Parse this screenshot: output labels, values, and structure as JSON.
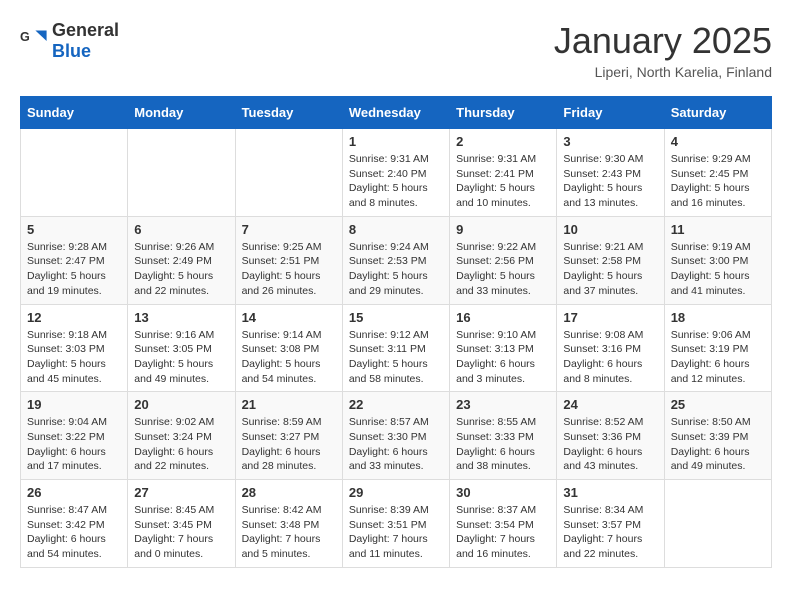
{
  "header": {
    "logo_general": "General",
    "logo_blue": "Blue",
    "month": "January 2025",
    "location": "Liperi, North Karelia, Finland"
  },
  "weekdays": [
    "Sunday",
    "Monday",
    "Tuesday",
    "Wednesday",
    "Thursday",
    "Friday",
    "Saturday"
  ],
  "weeks": [
    [
      {
        "day": "",
        "sunrise": "",
        "sunset": "",
        "daylight": ""
      },
      {
        "day": "",
        "sunrise": "",
        "sunset": "",
        "daylight": ""
      },
      {
        "day": "",
        "sunrise": "",
        "sunset": "",
        "daylight": ""
      },
      {
        "day": "1",
        "sunrise": "Sunrise: 9:31 AM",
        "sunset": "Sunset: 2:40 PM",
        "daylight": "Daylight: 5 hours and 8 minutes."
      },
      {
        "day": "2",
        "sunrise": "Sunrise: 9:31 AM",
        "sunset": "Sunset: 2:41 PM",
        "daylight": "Daylight: 5 hours and 10 minutes."
      },
      {
        "day": "3",
        "sunrise": "Sunrise: 9:30 AM",
        "sunset": "Sunset: 2:43 PM",
        "daylight": "Daylight: 5 hours and 13 minutes."
      },
      {
        "day": "4",
        "sunrise": "Sunrise: 9:29 AM",
        "sunset": "Sunset: 2:45 PM",
        "daylight": "Daylight: 5 hours and 16 minutes."
      }
    ],
    [
      {
        "day": "5",
        "sunrise": "Sunrise: 9:28 AM",
        "sunset": "Sunset: 2:47 PM",
        "daylight": "Daylight: 5 hours and 19 minutes."
      },
      {
        "day": "6",
        "sunrise": "Sunrise: 9:26 AM",
        "sunset": "Sunset: 2:49 PM",
        "daylight": "Daylight: 5 hours and 22 minutes."
      },
      {
        "day": "7",
        "sunrise": "Sunrise: 9:25 AM",
        "sunset": "Sunset: 2:51 PM",
        "daylight": "Daylight: 5 hours and 26 minutes."
      },
      {
        "day": "8",
        "sunrise": "Sunrise: 9:24 AM",
        "sunset": "Sunset: 2:53 PM",
        "daylight": "Daylight: 5 hours and 29 minutes."
      },
      {
        "day": "9",
        "sunrise": "Sunrise: 9:22 AM",
        "sunset": "Sunset: 2:56 PM",
        "daylight": "Daylight: 5 hours and 33 minutes."
      },
      {
        "day": "10",
        "sunrise": "Sunrise: 9:21 AM",
        "sunset": "Sunset: 2:58 PM",
        "daylight": "Daylight: 5 hours and 37 minutes."
      },
      {
        "day": "11",
        "sunrise": "Sunrise: 9:19 AM",
        "sunset": "Sunset: 3:00 PM",
        "daylight": "Daylight: 5 hours and 41 minutes."
      }
    ],
    [
      {
        "day": "12",
        "sunrise": "Sunrise: 9:18 AM",
        "sunset": "Sunset: 3:03 PM",
        "daylight": "Daylight: 5 hours and 45 minutes."
      },
      {
        "day": "13",
        "sunrise": "Sunrise: 9:16 AM",
        "sunset": "Sunset: 3:05 PM",
        "daylight": "Daylight: 5 hours and 49 minutes."
      },
      {
        "day": "14",
        "sunrise": "Sunrise: 9:14 AM",
        "sunset": "Sunset: 3:08 PM",
        "daylight": "Daylight: 5 hours and 54 minutes."
      },
      {
        "day": "15",
        "sunrise": "Sunrise: 9:12 AM",
        "sunset": "Sunset: 3:11 PM",
        "daylight": "Daylight: 5 hours and 58 minutes."
      },
      {
        "day": "16",
        "sunrise": "Sunrise: 9:10 AM",
        "sunset": "Sunset: 3:13 PM",
        "daylight": "Daylight: 6 hours and 3 minutes."
      },
      {
        "day": "17",
        "sunrise": "Sunrise: 9:08 AM",
        "sunset": "Sunset: 3:16 PM",
        "daylight": "Daylight: 6 hours and 8 minutes."
      },
      {
        "day": "18",
        "sunrise": "Sunrise: 9:06 AM",
        "sunset": "Sunset: 3:19 PM",
        "daylight": "Daylight: 6 hours and 12 minutes."
      }
    ],
    [
      {
        "day": "19",
        "sunrise": "Sunrise: 9:04 AM",
        "sunset": "Sunset: 3:22 PM",
        "daylight": "Daylight: 6 hours and 17 minutes."
      },
      {
        "day": "20",
        "sunrise": "Sunrise: 9:02 AM",
        "sunset": "Sunset: 3:24 PM",
        "daylight": "Daylight: 6 hours and 22 minutes."
      },
      {
        "day": "21",
        "sunrise": "Sunrise: 8:59 AM",
        "sunset": "Sunset: 3:27 PM",
        "daylight": "Daylight: 6 hours and 28 minutes."
      },
      {
        "day": "22",
        "sunrise": "Sunrise: 8:57 AM",
        "sunset": "Sunset: 3:30 PM",
        "daylight": "Daylight: 6 hours and 33 minutes."
      },
      {
        "day": "23",
        "sunrise": "Sunrise: 8:55 AM",
        "sunset": "Sunset: 3:33 PM",
        "daylight": "Daylight: 6 hours and 38 minutes."
      },
      {
        "day": "24",
        "sunrise": "Sunrise: 8:52 AM",
        "sunset": "Sunset: 3:36 PM",
        "daylight": "Daylight: 6 hours and 43 minutes."
      },
      {
        "day": "25",
        "sunrise": "Sunrise: 8:50 AM",
        "sunset": "Sunset: 3:39 PM",
        "daylight": "Daylight: 6 hours and 49 minutes."
      }
    ],
    [
      {
        "day": "26",
        "sunrise": "Sunrise: 8:47 AM",
        "sunset": "Sunset: 3:42 PM",
        "daylight": "Daylight: 6 hours and 54 minutes."
      },
      {
        "day": "27",
        "sunrise": "Sunrise: 8:45 AM",
        "sunset": "Sunset: 3:45 PM",
        "daylight": "Daylight: 7 hours and 0 minutes."
      },
      {
        "day": "28",
        "sunrise": "Sunrise: 8:42 AM",
        "sunset": "Sunset: 3:48 PM",
        "daylight": "Daylight: 7 hours and 5 minutes."
      },
      {
        "day": "29",
        "sunrise": "Sunrise: 8:39 AM",
        "sunset": "Sunset: 3:51 PM",
        "daylight": "Daylight: 7 hours and 11 minutes."
      },
      {
        "day": "30",
        "sunrise": "Sunrise: 8:37 AM",
        "sunset": "Sunset: 3:54 PM",
        "daylight": "Daylight: 7 hours and 16 minutes."
      },
      {
        "day": "31",
        "sunrise": "Sunrise: 8:34 AM",
        "sunset": "Sunset: 3:57 PM",
        "daylight": "Daylight: 7 hours and 22 minutes."
      },
      {
        "day": "",
        "sunrise": "",
        "sunset": "",
        "daylight": ""
      }
    ]
  ]
}
